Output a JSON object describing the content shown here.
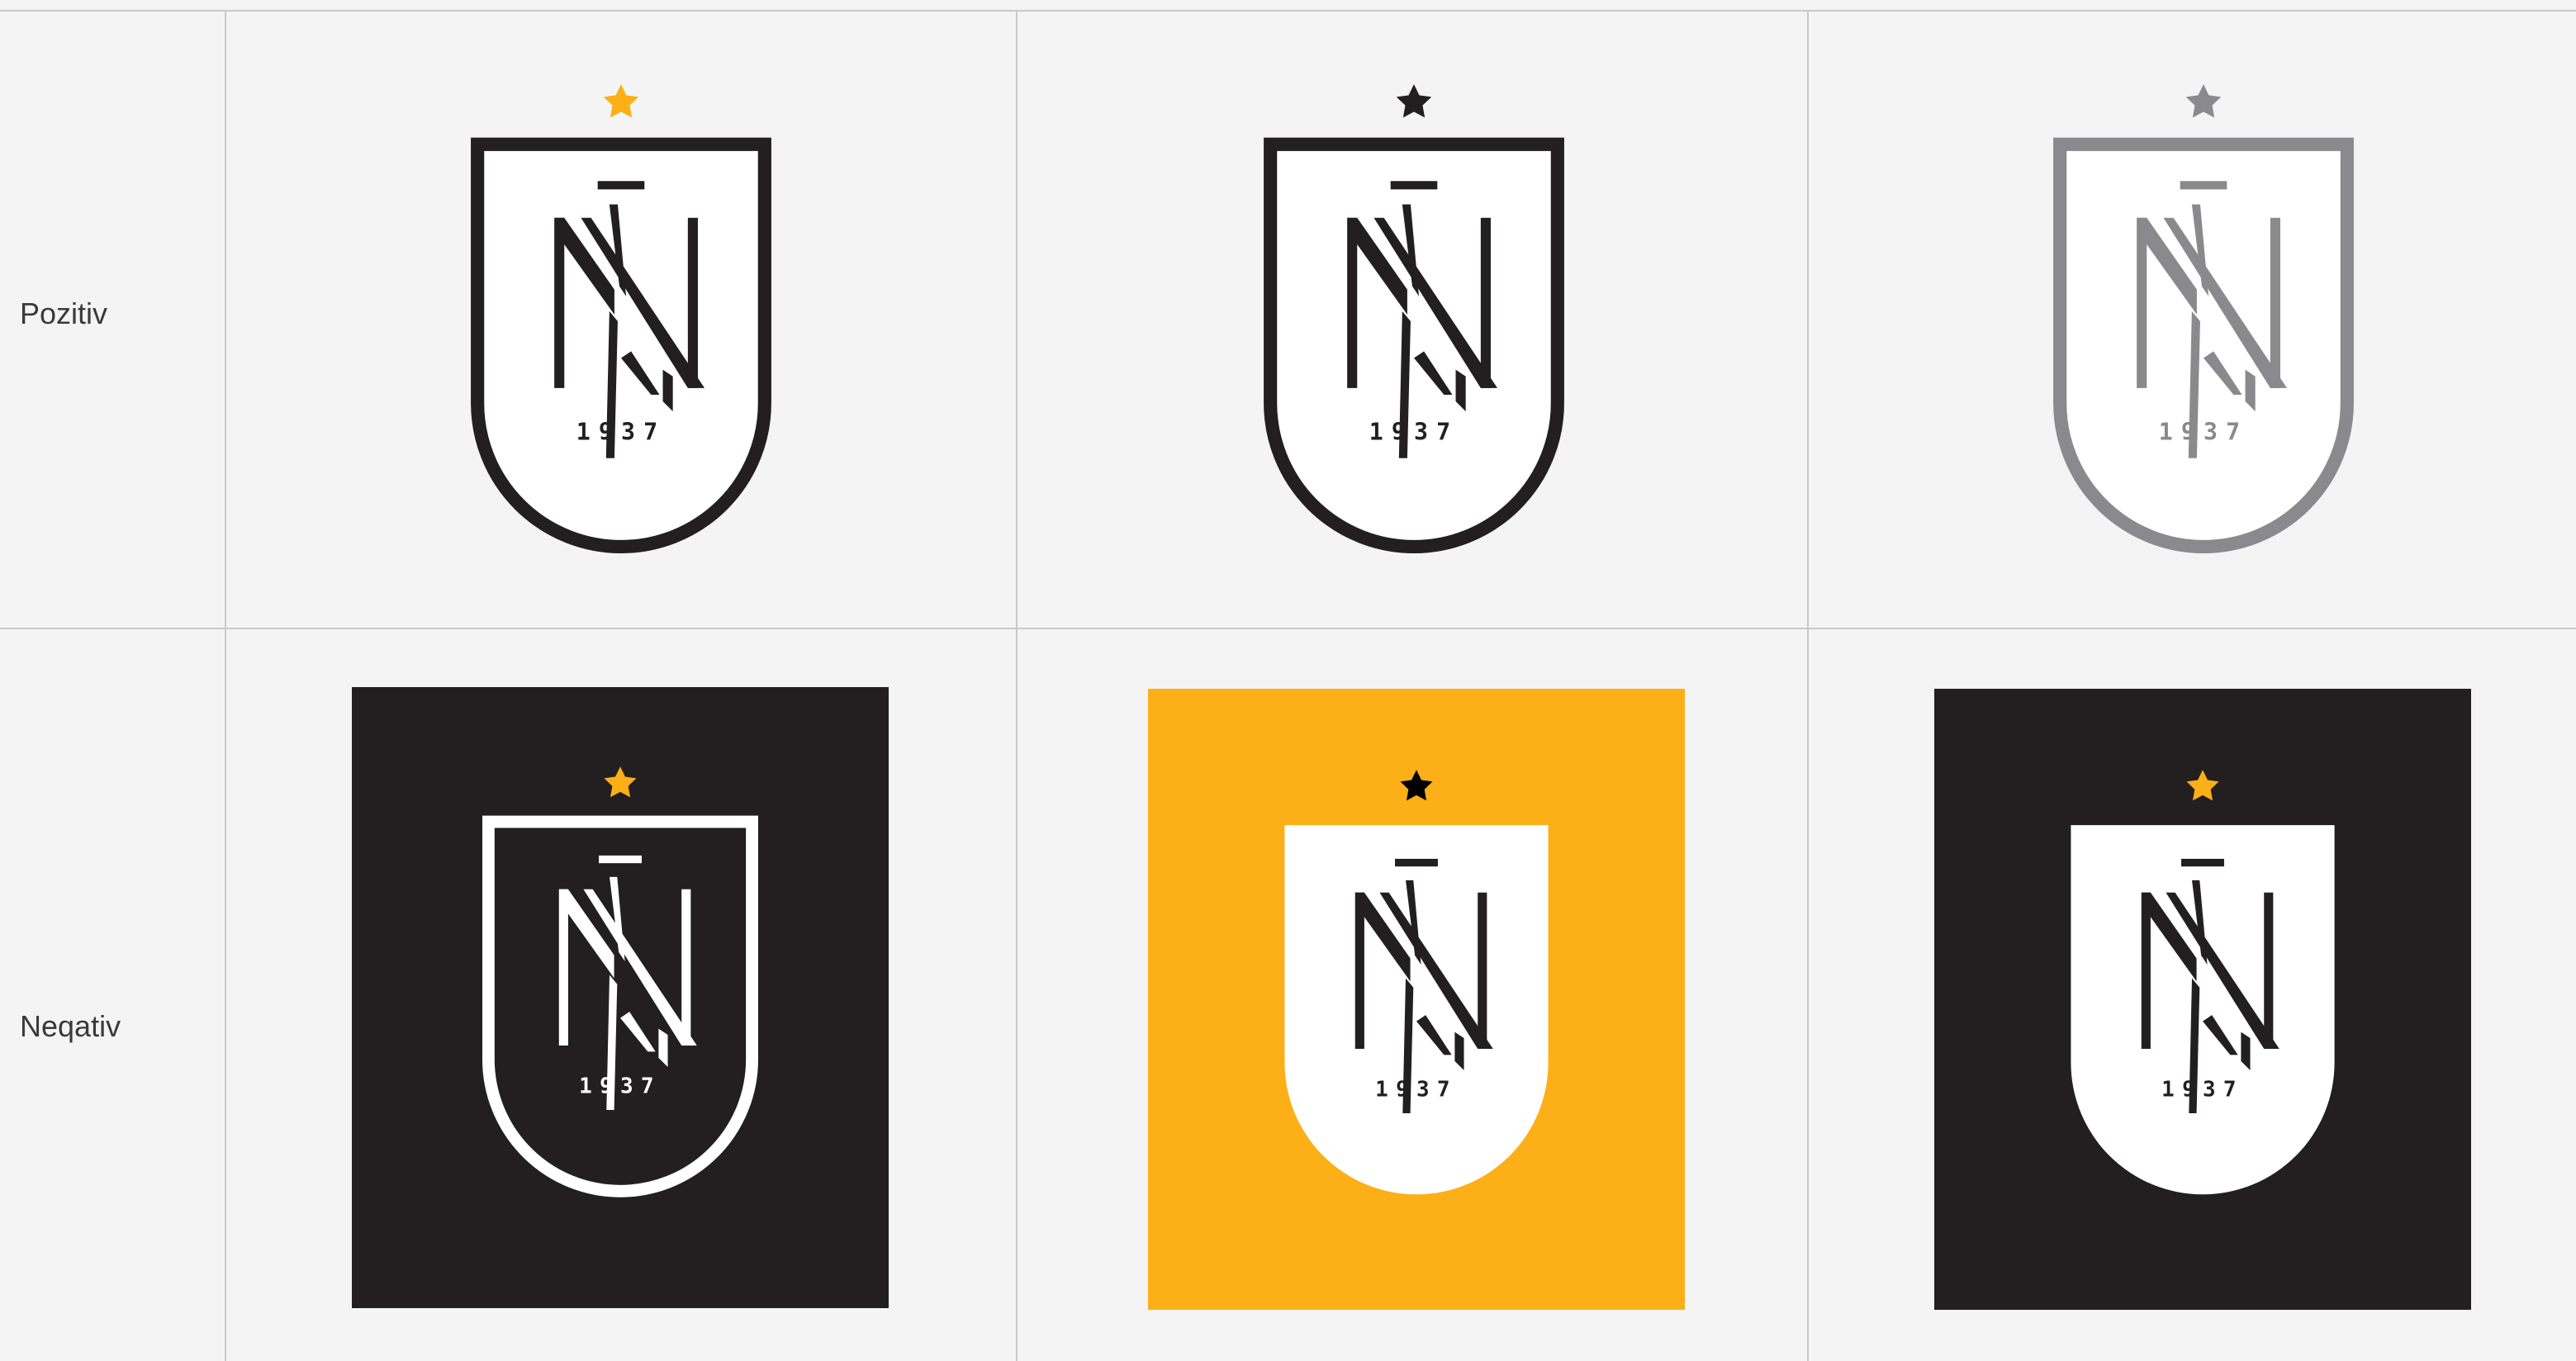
{
  "rows": [
    {
      "label": "Pozitiv"
    },
    {
      "label": "Neqativ"
    }
  ],
  "crest": {
    "year": "1937"
  },
  "colors": {
    "page_bg": "#f4f4f4",
    "grid_line": "#c9c9c9",
    "brand_black": "#231f20",
    "brand_yellow": "#fcaf17",
    "silver": "#8a8a8e",
    "white": "#ffffff"
  },
  "variants": [
    {
      "id": "pos-color",
      "row": "positive",
      "star": "#fcaf17",
      "shield_fill": "#ffffff",
      "outline": "#231f20",
      "monogram": "#231f20",
      "year_color": "#231f20",
      "background": "none"
    },
    {
      "id": "pos-black",
      "row": "positive",
      "star": "#231f20",
      "shield_fill": "#ffffff",
      "outline": "#231f20",
      "monogram": "#231f20",
      "year_color": "#231f20",
      "background": "none"
    },
    {
      "id": "pos-silver",
      "row": "positive",
      "star": "#8a8a8e",
      "shield_fill": "#ffffff",
      "outline": "#8a8a8e",
      "monogram": "#8a8a8e",
      "year_color": "#8a8a8e",
      "background": "none"
    },
    {
      "id": "neg-outline-on-black",
      "row": "negative",
      "star": "#fcaf17",
      "shield_fill": "#231f20",
      "outline": "#ffffff",
      "monogram": "#ffffff",
      "year_color": "#ffffff",
      "background": "#231f20"
    },
    {
      "id": "neg-on-yellow",
      "row": "negative",
      "star": "#000000",
      "shield_fill": "#ffffff",
      "outline": "none",
      "monogram": "#231f20",
      "year_color": "#231f20",
      "background": "#fcaf17"
    },
    {
      "id": "neg-on-black",
      "row": "negative",
      "star": "#fcaf17",
      "shield_fill": "#ffffff",
      "outline": "none",
      "monogram": "#231f20",
      "year_color": "#231f20",
      "background": "#231f20"
    }
  ]
}
